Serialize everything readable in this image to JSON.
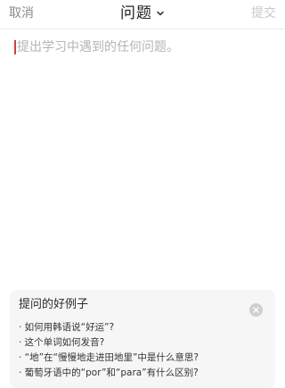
{
  "header": {
    "cancel_label": "取消",
    "title": "问题",
    "submit_label": "提交"
  },
  "editor": {
    "placeholder": "提出学习中遇到的任何问题。"
  },
  "tips": {
    "title": "提问的好例子",
    "items": [
      "· 如何用韩语说“好运”?",
      "· 这个单词如何发音?",
      "· “地”在“慢慢地走进田地里”中是什么意思?",
      "· 葡萄牙语中的“por”和“para”有什么区别?"
    ]
  },
  "colors": {
    "caret": "#e53935",
    "submit_disabled": "#c8c8c8",
    "tips_background": "#f6f6f6"
  },
  "icons": {
    "title_dropdown": "chevron-down-icon",
    "tips_close": "close-icon"
  }
}
